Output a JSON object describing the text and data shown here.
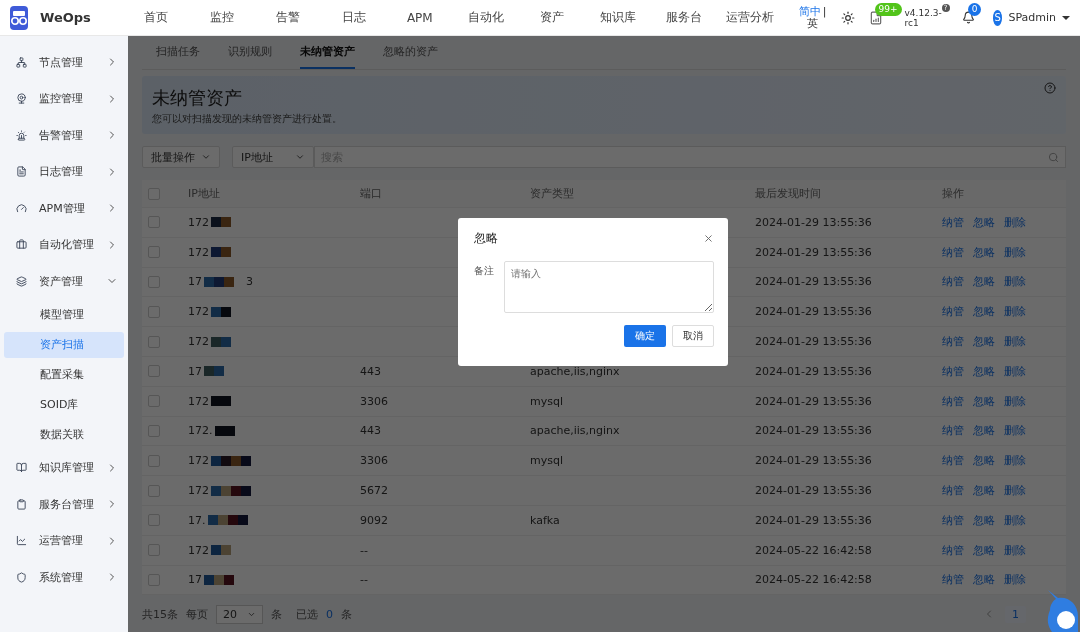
{
  "topbar": {
    "brand": "WeOps",
    "nav": [
      "首页",
      "监控",
      "告警",
      "日志",
      "APM",
      "自动化",
      "资产",
      "知识库",
      "服务台",
      "运营分析"
    ],
    "language": {
      "primary": "简中",
      "separator": "|",
      "secondary": "英"
    },
    "notice_badge": "99+",
    "version": "v4.12.3-rc1",
    "version_mark": "?",
    "bell_badge": "0",
    "avatar": "S",
    "user": "SPadmin"
  },
  "sidebar": {
    "items": [
      {
        "label": "节点管理",
        "expanded": false
      },
      {
        "label": "监控管理",
        "expanded": false
      },
      {
        "label": "告警管理",
        "expanded": false
      },
      {
        "label": "日志管理",
        "expanded": false
      },
      {
        "label": "APM管理",
        "expanded": false
      },
      {
        "label": "自动化管理",
        "expanded": false
      },
      {
        "label": "资产管理",
        "expanded": true,
        "children": [
          {
            "label": "模型管理",
            "selected": false
          },
          {
            "label": "资产扫描",
            "selected": true
          },
          {
            "label": "配置采集",
            "selected": false
          },
          {
            "label": "SOID库",
            "selected": false
          },
          {
            "label": "数据关联",
            "selected": false
          }
        ]
      },
      {
        "label": "知识库管理",
        "expanded": false
      },
      {
        "label": "服务台管理",
        "expanded": false
      },
      {
        "label": "运营管理",
        "expanded": false
      },
      {
        "label": "系统管理",
        "expanded": false
      }
    ]
  },
  "tabs": [
    {
      "label": "扫描任务",
      "selected": false
    },
    {
      "label": "识别规则",
      "selected": false
    },
    {
      "label": "未纳管资产",
      "selected": true
    },
    {
      "label": "忽略的资产",
      "selected": false
    }
  ],
  "banner": {
    "title": "未纳管资产",
    "description": "您可以对扫描发现的未纳管资产进行处置。"
  },
  "toolbar": {
    "bulk": "批量操作",
    "field": "IP地址",
    "search_placeholder": "搜索"
  },
  "table": {
    "columns": [
      "IP地址",
      "端口",
      "资产类型",
      "最后发现时间",
      "操作"
    ],
    "header_checked": false,
    "rows": [
      {
        "checked": false,
        "ip": "172",
        "time": "2024-01-29 13:55:36",
        "actions": [
          "纳管",
          "忽略",
          "删除"
        ]
      },
      {
        "checked": false,
        "ip": "172",
        "time": "2024-01-29 13:55:36",
        "actions": [
          "纳管",
          "忽略",
          "删除"
        ]
      },
      {
        "checked": false,
        "ip": "17",
        "ip_tail": "3",
        "time": "2024-01-29 13:55:36",
        "actions": [
          "纳管",
          "忽略",
          "删除"
        ]
      },
      {
        "checked": false,
        "ip": "172",
        "time": "2024-01-29 13:55:36",
        "actions": [
          "纳管",
          "忽略",
          "删除"
        ]
      },
      {
        "checked": false,
        "ip": "172",
        "time": "2024-01-29 13:55:36",
        "actions": [
          "纳管",
          "忽略",
          "删除"
        ]
      },
      {
        "checked": false,
        "ip": "17",
        "port": "443",
        "type": "apache,iis,nginx",
        "time": "2024-01-29 13:55:36",
        "actions": [
          "纳管",
          "忽略",
          "删除"
        ]
      },
      {
        "checked": false,
        "ip": "172",
        "port": "3306",
        "type": "mysql",
        "time": "2024-01-29 13:55:36",
        "actions": [
          "纳管",
          "忽略",
          "删除"
        ]
      },
      {
        "checked": false,
        "ip": "172.",
        "port": "443",
        "type": "apache,iis,nginx",
        "time": "2024-01-29 13:55:36",
        "actions": [
          "纳管",
          "忽略",
          "删除"
        ]
      },
      {
        "checked": false,
        "ip": "172",
        "port": "3306",
        "type": "mysql",
        "time": "2024-01-29 13:55:36",
        "actions": [
          "纳管",
          "忽略",
          "删除"
        ]
      },
      {
        "checked": false,
        "ip": "172",
        "port": "5672",
        "time": "2024-01-29 13:55:36",
        "actions": [
          "纳管",
          "忽略",
          "删除"
        ]
      },
      {
        "checked": false,
        "ip": "17.",
        "port": "9092",
        "type": "kafka",
        "time": "2024-01-29 13:55:36",
        "actions": [
          "纳管",
          "忽略",
          "删除"
        ]
      },
      {
        "checked": false,
        "ip": "172",
        "port": "--",
        "time": "2024-05-22 16:42:58",
        "actions": [
          "纳管",
          "忽略",
          "删除"
        ]
      },
      {
        "checked": false,
        "ip": "17",
        "port": "--",
        "time": "2024-05-22 16:42:58",
        "actions": [
          "纳管",
          "忽略",
          "删除"
        ]
      }
    ]
  },
  "pagination": {
    "total": "共15条",
    "per_page_label": "每页",
    "per_page": "20",
    "per_page_unit": "条",
    "selected_label": "已选",
    "selected_count": "0",
    "selected_unit": "条",
    "pages": [
      {
        "label": "1",
        "selected": true
      }
    ]
  },
  "dialog": {
    "title": "忽略",
    "field_label": "备注",
    "placeholder": "请输入",
    "ok": "确定",
    "cancel": "取消"
  }
}
